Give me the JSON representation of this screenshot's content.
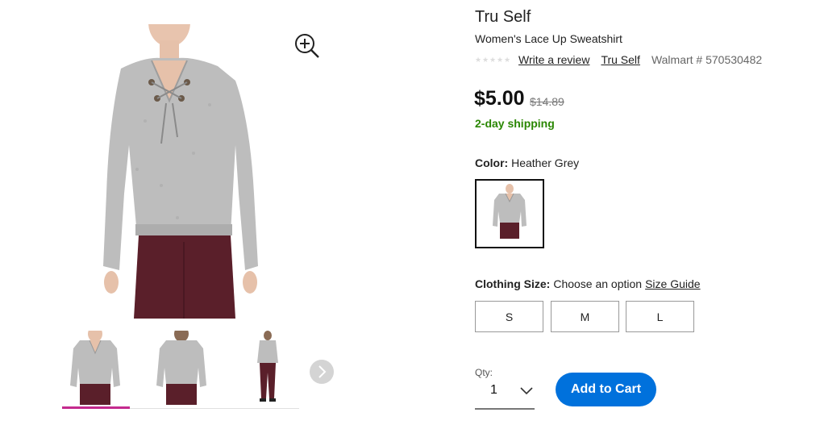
{
  "product": {
    "brand": "Tru Self",
    "name": "Women's Lace Up Sweatshirt",
    "rating_stars": 0,
    "write_review_label": "Write a review",
    "brand_link": "Tru Self",
    "walmart_number": "Walmart # 570530482",
    "price": "$5.00",
    "was_price": "$14.89",
    "shipping": "2-day shipping"
  },
  "color": {
    "label": "Color:",
    "selected": "Heather Grey"
  },
  "size": {
    "label": "Clothing Size:",
    "prompt": "Choose an option",
    "guide_link": "Size Guide",
    "options": [
      "S",
      "M",
      "L"
    ]
  },
  "quantity": {
    "label": "Qty:",
    "value": "1"
  },
  "cart": {
    "button_label": "Add to Cart"
  },
  "gallery": {
    "thumbnail_count": 3,
    "selected_index": 0
  },
  "icons": {
    "zoom": "zoom-in-icon",
    "next": "chevron-right-icon",
    "qty_dropdown": "chevron-down-icon",
    "star": "star-icon"
  },
  "colors": {
    "sweater": "#b9b9b9",
    "pants": "#5a1f2a",
    "accent": "#0071dc",
    "shipping": "#2a8703",
    "thumb_underline": "#c42a8e"
  }
}
